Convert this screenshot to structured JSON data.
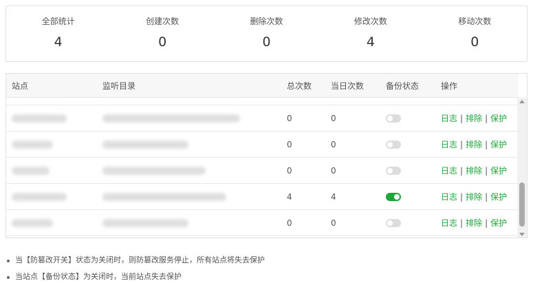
{
  "stats": [
    {
      "label": "全部统计",
      "value": "4"
    },
    {
      "label": "创建次数",
      "value": "0"
    },
    {
      "label": "删除次数",
      "value": "0"
    },
    {
      "label": "修改次数",
      "value": "4"
    },
    {
      "label": "移动次数",
      "value": "0"
    }
  ],
  "table": {
    "headers": {
      "site": "站点",
      "dir": "监听目录",
      "total": "总次数",
      "today": "当日次数",
      "backup": "备份状态",
      "ops": "操作"
    },
    "ops_labels": {
      "log": "日志",
      "exclude": "排除",
      "protect": "保护",
      "sep": "|"
    },
    "rows": [
      {
        "total": "0",
        "today": "0",
        "backup": false
      },
      {
        "total": "0",
        "today": "0",
        "backup": false
      },
      {
        "total": "0",
        "today": "0",
        "backup": false
      },
      {
        "total": "4",
        "today": "4",
        "backup": true
      },
      {
        "total": "0",
        "today": "0",
        "backup": false
      }
    ]
  },
  "notes": [
    "当【防篡改开关】状态为关闭时，则防篡改服务停止，所有站点将失去保护",
    "当站点【备份状态】为关闭时，当前站点失去保护"
  ],
  "colors": {
    "accent": "#20a53a",
    "toggle_off": "#dddddd"
  }
}
